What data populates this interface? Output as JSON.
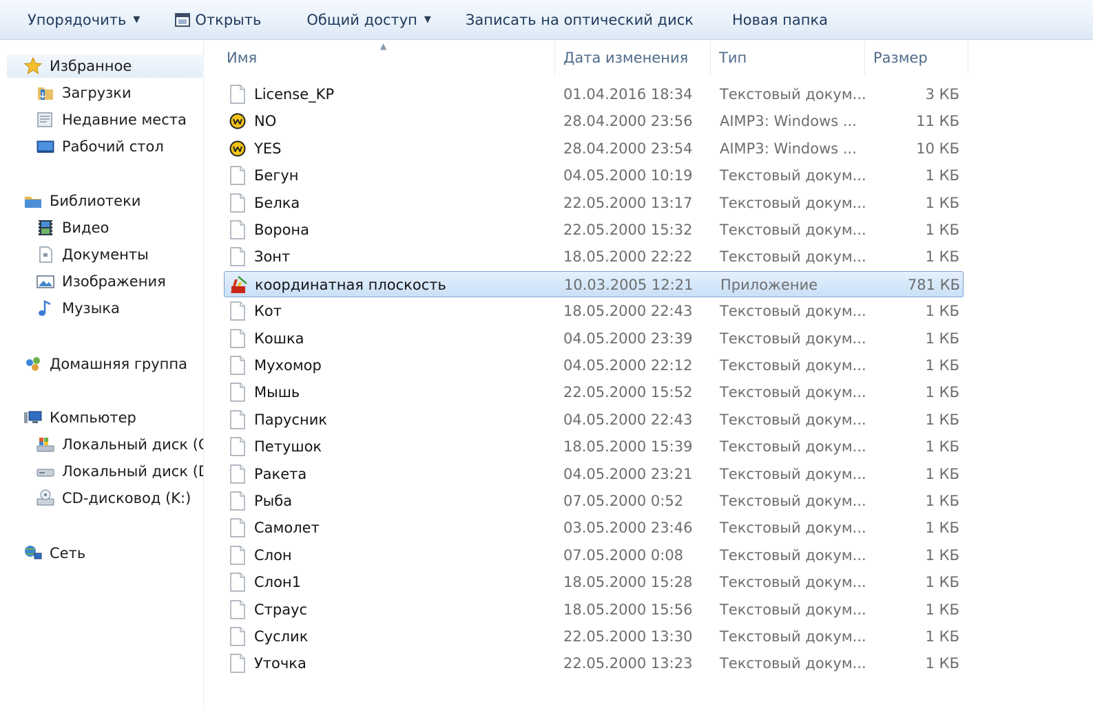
{
  "toolbar": {
    "organize_label": "Упорядочить",
    "open_label": "Открыть",
    "share_label": "Общий доступ",
    "burn_label": "Записать на оптический диск",
    "new_folder_label": "Новая папка"
  },
  "nav": {
    "favorites": {
      "label": "Избранное",
      "items": [
        "Загрузки",
        "Недавние места",
        "Рабочий стол"
      ]
    },
    "libraries": {
      "label": "Библиотеки",
      "items": [
        "Видео",
        "Документы",
        "Изображения",
        "Музыка"
      ]
    },
    "homegroup": {
      "label": "Домашняя группа"
    },
    "computer": {
      "label": "Компьютер",
      "items": [
        "Локальный диск (C",
        "Локальный диск (D",
        "CD-дисковод (K:)"
      ]
    },
    "network": {
      "label": "Сеть"
    }
  },
  "columns": {
    "name": "Имя",
    "date": "Дата изменения",
    "type": "Тип",
    "size": "Размер"
  },
  "files": [
    {
      "name": "License_KP",
      "date": "01.04.2016 18:34",
      "type": "Текстовый докум...",
      "size": "3 КБ",
      "icon": "text-file-icon"
    },
    {
      "name": "NO",
      "date": "28.04.2000 23:56",
      "type": "AIMP3: Windows ...",
      "size": "11 КБ",
      "icon": "aimp-audio-icon"
    },
    {
      "name": "YES",
      "date": "28.04.2000 23:54",
      "type": "AIMP3: Windows ...",
      "size": "10 КБ",
      "icon": "aimp-audio-icon"
    },
    {
      "name": "Бегун",
      "date": "04.05.2000 10:19",
      "type": "Текстовый докум...",
      "size": "1 КБ",
      "icon": "text-file-icon"
    },
    {
      "name": "Белка",
      "date": "22.05.2000 13:17",
      "type": "Текстовый докум...",
      "size": "1 КБ",
      "icon": "text-file-icon"
    },
    {
      "name": "Ворона",
      "date": "22.05.2000 15:32",
      "type": "Текстовый докум...",
      "size": "1 КБ",
      "icon": "text-file-icon"
    },
    {
      "name": "Зонт",
      "date": "18.05.2000 22:22",
      "type": "Текстовый докум...",
      "size": "1 КБ",
      "icon": "text-file-icon"
    },
    {
      "name": "координатная плоскость",
      "date": "10.03.2005 12:21",
      "type": "Приложение",
      "size": "781 КБ",
      "icon": "application-icon",
      "selected": true
    },
    {
      "name": "Кот",
      "date": "18.05.2000 22:43",
      "type": "Текстовый докум...",
      "size": "1 КБ",
      "icon": "text-file-icon"
    },
    {
      "name": "Кошка",
      "date": "04.05.2000 23:39",
      "type": "Текстовый докум...",
      "size": "1 КБ",
      "icon": "text-file-icon"
    },
    {
      "name": "Мухомор",
      "date": "04.05.2000 22:12",
      "type": "Текстовый докум...",
      "size": "1 КБ",
      "icon": "text-file-icon"
    },
    {
      "name": "Мышь",
      "date": "22.05.2000 15:52",
      "type": "Текстовый докум...",
      "size": "1 КБ",
      "icon": "text-file-icon"
    },
    {
      "name": "Парусник",
      "date": "04.05.2000 22:43",
      "type": "Текстовый докум...",
      "size": "1 КБ",
      "icon": "text-file-icon"
    },
    {
      "name": "Петушок",
      "date": "18.05.2000 15:39",
      "type": "Текстовый докум...",
      "size": "1 КБ",
      "icon": "text-file-icon"
    },
    {
      "name": "Ракета",
      "date": "04.05.2000 23:21",
      "type": "Текстовый докум...",
      "size": "1 КБ",
      "icon": "text-file-icon"
    },
    {
      "name": "Рыба",
      "date": "07.05.2000 0:52",
      "type": "Текстовый докум...",
      "size": "1 КБ",
      "icon": "text-file-icon"
    },
    {
      "name": "Самолет",
      "date": "03.05.2000 23:46",
      "type": "Текстовый докум...",
      "size": "1 КБ",
      "icon": "text-file-icon"
    },
    {
      "name": "Слон",
      "date": "07.05.2000 0:08",
      "type": "Текстовый докум...",
      "size": "1 КБ",
      "icon": "text-file-icon"
    },
    {
      "name": "Слон1",
      "date": "18.05.2000 15:28",
      "type": "Текстовый докум...",
      "size": "1 КБ",
      "icon": "text-file-icon"
    },
    {
      "name": "Страус",
      "date": "18.05.2000 15:56",
      "type": "Текстовый докум...",
      "size": "1 КБ",
      "icon": "text-file-icon"
    },
    {
      "name": "Суслик",
      "date": "22.05.2000 13:30",
      "type": "Текстовый докум...",
      "size": "1 КБ",
      "icon": "text-file-icon"
    },
    {
      "name": "Уточка",
      "date": "22.05.2000 13:23",
      "type": "Текстовый докум...",
      "size": "1 КБ",
      "icon": "text-file-icon"
    }
  ],
  "colors": {
    "toolbar_text": "#1e3a5c",
    "selection_border": "#7da2ce",
    "header_text": "#4f6b8a",
    "secondary_text": "#6d6d6d"
  }
}
